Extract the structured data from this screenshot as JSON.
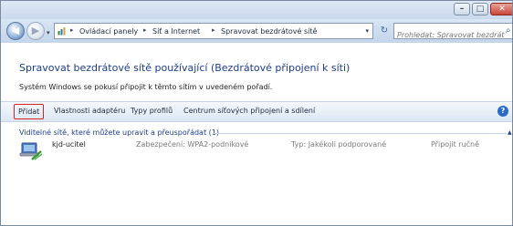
{
  "window": {
    "buttons": {
      "minimize": "–",
      "maximize": "□",
      "close": "✕"
    }
  },
  "navigation": {
    "back": "◀",
    "forward": "▶",
    "dropdown": "▾",
    "refresh": "↻",
    "breadcrumbs": [
      "Ovládací panely",
      "Síť a Internet",
      "Spravovat bezdrátové sítě"
    ],
    "separator": "▸",
    "search_placeholder": "Prohledat: Spravovat bezdrátové sítě"
  },
  "header": {
    "title": "Spravovat bezdrátové sítě používající (Bezdrátové připojení k síti)",
    "description": "Systém Windows se pokusí připojit k těmto sítím v uvedeném pořadí."
  },
  "toolbar": {
    "add": "Přidat",
    "adapter_properties": "Vlastnosti adaptéru",
    "profile_types": "Typy profilů",
    "network_center": "Centrum síťových připojení a sdílení",
    "help": "?"
  },
  "group": {
    "label": "Viditelné sítě, které můžete upravit a přeuspořádat (1)",
    "collapse": "▲"
  },
  "networks": [
    {
      "name": "kjd-ucitel",
      "security": "Zabezpečení: WPA2-podnikové",
      "type": "Typ: Jakékoli podporované",
      "connect": "Připojit ručně",
      "icon": "wireless-network-icon"
    }
  ],
  "colors": {
    "title_blue": "#1e3d8f",
    "highlight_red": "#dd2222",
    "close_red": "#c9463a"
  }
}
